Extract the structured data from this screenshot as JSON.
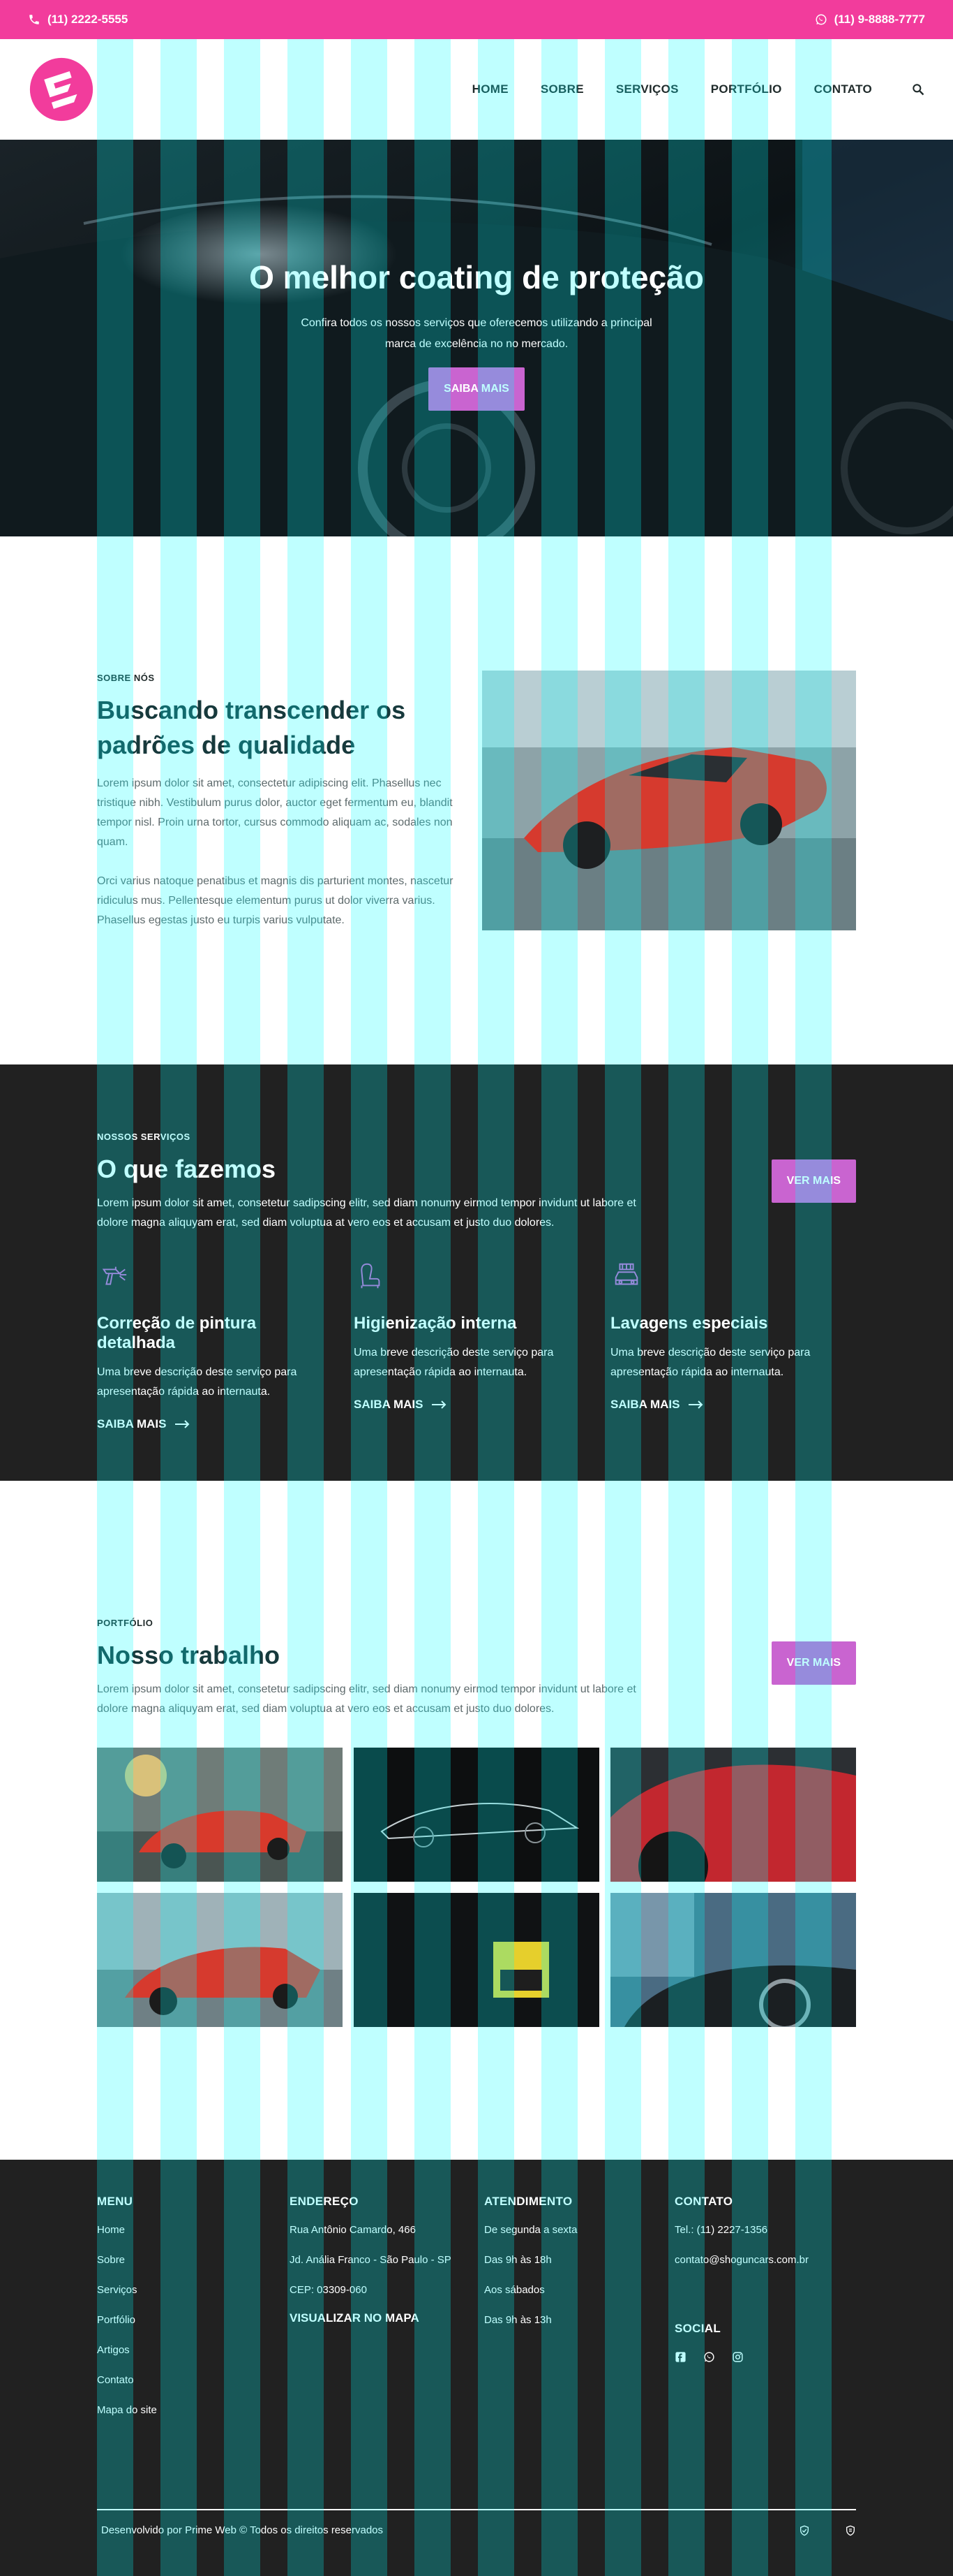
{
  "topbar": {
    "phone": "(11) 2222-5555",
    "whatsapp": "(11) 9-8888-7777"
  },
  "nav": {
    "items": [
      "HOME",
      "SOBRE",
      "SERVIÇOS",
      "PORTFÓLIO",
      "CONTATO"
    ]
  },
  "hero": {
    "title": "O melhor coating de proteção",
    "subtitle": "Confira todos os nossos serviços que oferecemos utilizando a principal marca de excelência no no mercado.",
    "button": "SAIBA MAIS"
  },
  "about": {
    "eyebrow": "SOBRE NÓS",
    "title": "Buscando transcender os padrões de qualidade",
    "p1": "Lorem ipsum dolor sit amet, consectetur adipiscing elit. Phasellus nec tristique nibh. Vestibulum purus dolor, auctor eget fermentum eu, blandit tempor nisl. Proin urna tortor, cursus commodo aliquam ac, sodales non quam.",
    "p2": "Orci varius natoque penatibus et magnis dis parturient montes, nascetur ridiculus mus. Pellentesque elementum purus ut dolor viverra varius. Phasellus egestas justo eu turpis varius vulputate."
  },
  "services": {
    "eyebrow": "NOSSOS SERVIÇOS",
    "title": "O que fazemos",
    "desc": "Lorem ipsum dolor sit amet, consetetur sadipscing elitr, sed diam nonumy eirmod tempor invidunt ut labore et dolore magna aliquyam erat, sed diam voluptua at vero eos et accusam et justo duo dolores.",
    "button": "VER MAIS",
    "items": [
      {
        "title": "Correção de pintura detalhada",
        "text": "Uma breve descrição deste serviço para apresentação rápida ao internauta.",
        "more": "SAIBA MAIS"
      },
      {
        "title": "Higienização interna",
        "text": "Uma breve descrição deste serviço para apresentação rápida ao internauta.",
        "more": "SAIBA MAIS"
      },
      {
        "title": "Lavagens especiais",
        "text": "Uma breve descrição deste serviço para apresentação rápida ao internauta.",
        "more": "SAIBA MAIS"
      }
    ],
    "accent": "#c964d0"
  },
  "portfolio": {
    "eyebrow": "PORTFÓLIO",
    "title": "Nosso trabalho",
    "desc": "Lorem ipsum dolor sit amet, consetetur sadipscing elitr, sed diam nonumy eirmod tempor invidunt ut labore et dolore magna aliquyam erat, sed diam voluptua at vero eos et accusam et justo duo dolores.",
    "button": "VER MAIS"
  },
  "footer": {
    "menu": {
      "title": "MENU",
      "items": [
        "Home",
        "Sobre",
        "Serviços",
        "Portfólio",
        "Artigos",
        "Contato",
        "Mapa do site"
      ]
    },
    "address": {
      "title": "ENDEREÇO",
      "lines": [
        "Rua Antônio Camardo, 466",
        "Jd. Anália Franco - São Paulo - SP",
        "CEP: 03309-060"
      ],
      "map": "VISUALIZAR NO MAPA"
    },
    "hours": {
      "title": "ATENDIMENTO",
      "lines": [
        "De segunda a sexta",
        "Das 9h às 18h",
        "Aos sábados",
        "Das 9h às 13h"
      ]
    },
    "contact": {
      "title": "CONTATO",
      "lines": [
        "Tel.: (11) 2227-1356",
        "contato@shoguncars.com.br"
      ]
    },
    "social": {
      "title": "SOCIAL"
    },
    "credits": "Desenvolvido por Prime Web  © Todos os direitos reservados"
  },
  "colors": {
    "brand_pink": "#f23c9c",
    "button": "#c964d0",
    "dark": "#212121",
    "heading": "#17393c"
  }
}
